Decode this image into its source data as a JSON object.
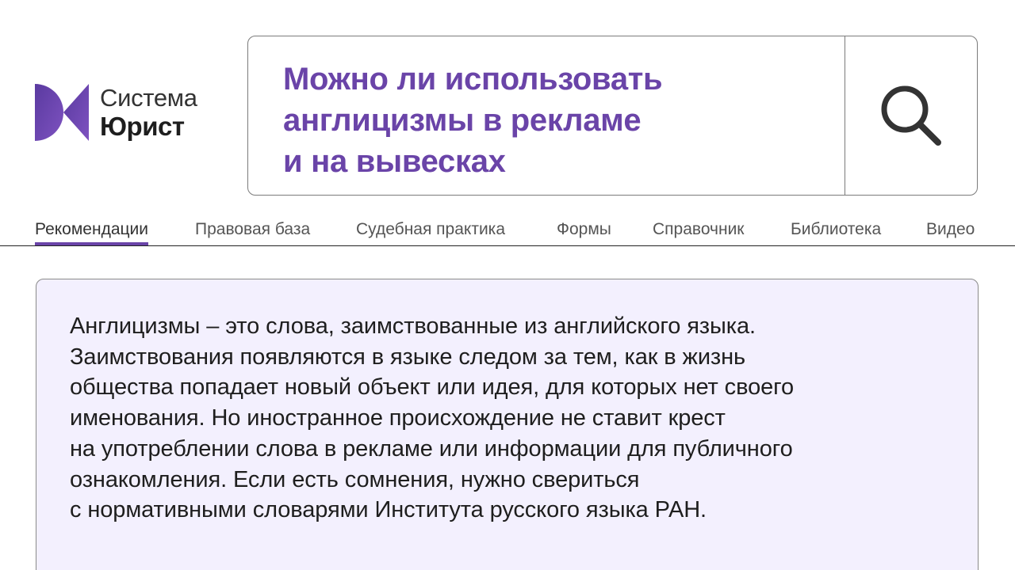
{
  "logo": {
    "line1": "Система",
    "line2": "Юрист",
    "brand_color": "#6a44a8"
  },
  "search": {
    "query": "Можно ли использовать\nанглицизмы в рекламе\nи на вывесках",
    "button_icon": "search-icon",
    "query_color": "#6a44a8"
  },
  "tabs": [
    {
      "label": "Рекомендации",
      "active": true
    },
    {
      "label": "Правовая база",
      "active": false
    },
    {
      "label": "Судебная практика",
      "active": false
    },
    {
      "label": "Формы",
      "active": false
    },
    {
      "label": "Справочник",
      "active": false
    },
    {
      "label": "Библиотека",
      "active": false
    },
    {
      "label": "Видео",
      "active": false
    }
  ],
  "answer": {
    "text": "Англицизмы – это слова, заимствованные из английского языка.\nЗаимствования появляются в языке следом за тем, как в жизнь\nобщества попадает новый объект или идея, для которых нет своего\nименования. Но иностранное происхождение не ставит крест\nна употреблении слова в рекламе или информации для публичного\nознакомления. Если есть сомнения, нужно свериться\nс нормативными словарями Института русского языка РАН.",
    "background": "#f3f0fe"
  }
}
